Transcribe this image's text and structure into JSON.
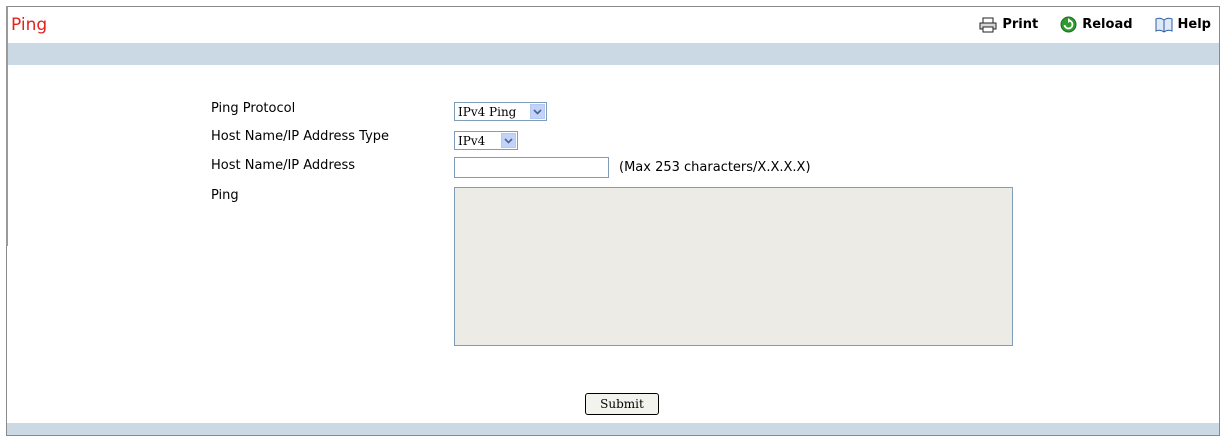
{
  "page": {
    "title": "Ping"
  },
  "toolbar": {
    "print": "Print",
    "reload": "Reload",
    "help": "Help"
  },
  "form": {
    "ping_protocol_label": "Ping Protocol",
    "ping_protocol_value": "IPv4 Ping",
    "host_type_label": "Host Name/IP Address Type",
    "host_type_value": "IPv4",
    "host_label": "Host Name/IP Address",
    "host_value": "",
    "host_hint": "(Max 253 characters/X.X.X.X)",
    "ping_label": "Ping",
    "ping_output": ""
  },
  "actions": {
    "submit": "Submit"
  },
  "colors": {
    "title": "#e3231b",
    "band": "#cad9e3",
    "output_bg": "#ecebe5"
  },
  "icons": {
    "print": "printer-icon",
    "reload": "reload-icon",
    "help": "help-book-icon",
    "dropdown": "chevron-down-icon"
  }
}
